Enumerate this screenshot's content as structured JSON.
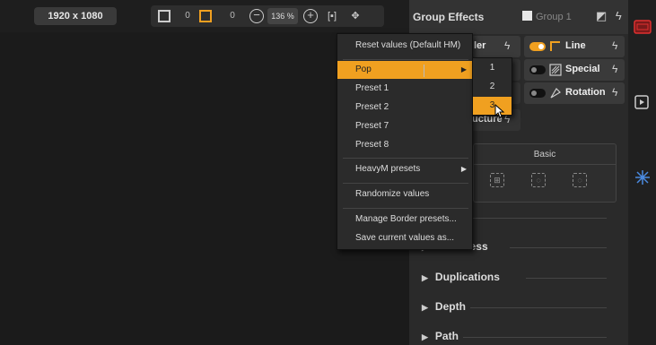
{
  "toolbar": {
    "resolution": "1920 x 1080",
    "value_a": "0",
    "value_b": "0",
    "zoom": "136 %"
  },
  "panel": {
    "title": "Group Effects",
    "group_label": "Group 1",
    "modifiers": [
      {
        "label": "Line"
      },
      {
        "label": "Special"
      },
      {
        "label": "Rotation"
      }
    ],
    "partial_tabs": {
      "border": "ler",
      "structure": "ucture"
    },
    "basic_label": "Basic",
    "sections": [
      "Thickness",
      "Duplications",
      "Depth",
      "Path"
    ]
  },
  "menu": {
    "items": [
      {
        "label": "Reset values (Default HM)"
      },
      {
        "label": "Pop",
        "has_submenu": true,
        "active": true
      },
      {
        "label": "Preset 1"
      },
      {
        "label": "Preset 2"
      },
      {
        "label": "Preset 7"
      },
      {
        "label": "Preset 8"
      },
      {
        "label": "HeavyM presets",
        "has_submenu": true
      },
      {
        "label": "Randomize values"
      },
      {
        "label": "Manage Border presets..."
      },
      {
        "label": "Save current values as..."
      }
    ]
  },
  "submenu": {
    "items": [
      "1",
      "2",
      "3"
    ],
    "active_index": 2
  },
  "colors": {
    "accent": "#f0a020",
    "panel_bg": "#2a2a2a",
    "menu_bg": "#2b2b2b"
  }
}
